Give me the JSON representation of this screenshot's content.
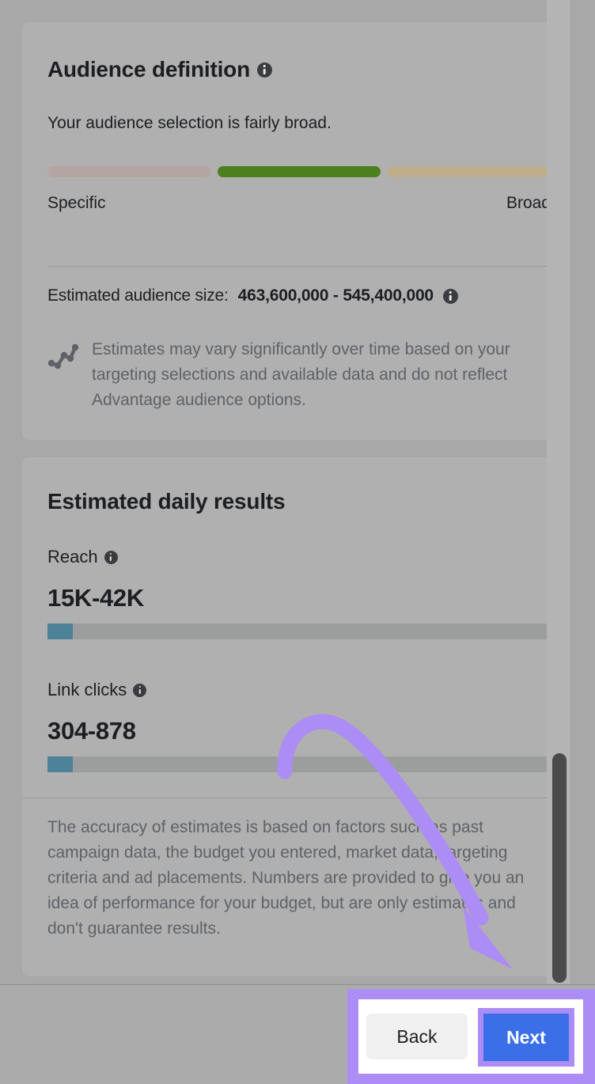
{
  "audience_card": {
    "title": "Audience definition",
    "info_icon": "info-icon",
    "summary": "Your audience selection is fairly broad.",
    "meter": {
      "segments": [
        {
          "name": "specific-segment",
          "color": "#b5a5a2",
          "active": false
        },
        {
          "name": "middle-segment",
          "color": "#4c801e",
          "active": true
        },
        {
          "name": "broad-segment",
          "color": "#bfae8c",
          "active": false
        }
      ],
      "left_label": "Specific",
      "right_label": "Broad"
    },
    "estimated_size_label": "Estimated audience size:",
    "estimated_size_value": "463,600,000 - 545,400,000",
    "note_icon": "trend-line-icon",
    "note": "Estimates may vary significantly over time based on your targeting selections and available data and do not reflect Advantage audience options."
  },
  "results_card": {
    "title": "Estimated daily results",
    "metrics": [
      {
        "name": "reach",
        "label": "Reach",
        "value": "15K-42K",
        "bar_fill_percent": 5,
        "bar_fill_color": "#4d8298",
        "bar_track_color": "#9c9e9e"
      },
      {
        "name": "link-clicks",
        "label": "Link clicks",
        "value": "304-878",
        "bar_fill_percent": 5,
        "bar_fill_color": "#4d8298",
        "bar_track_color": "#9c9e9e"
      }
    ],
    "disclaimer": "The accuracy of estimates is based on factors such as past campaign data, the budget you entered, market data, targeting criteria and ad placements. Numbers are provided to give you an idea of performance for your budget, but are only estimates and don't guarantee results."
  },
  "footer": {
    "back_label": "Back",
    "next_label": "Next"
  },
  "annotations": {
    "highlight_color": "#ac8cf5",
    "arrow_color": "#ac8cf5",
    "next_button_color": "#3b6fe8"
  },
  "scrollbar": {
    "thumb_color": "#4b4b4b",
    "track_color": "#b4b4b4"
  }
}
